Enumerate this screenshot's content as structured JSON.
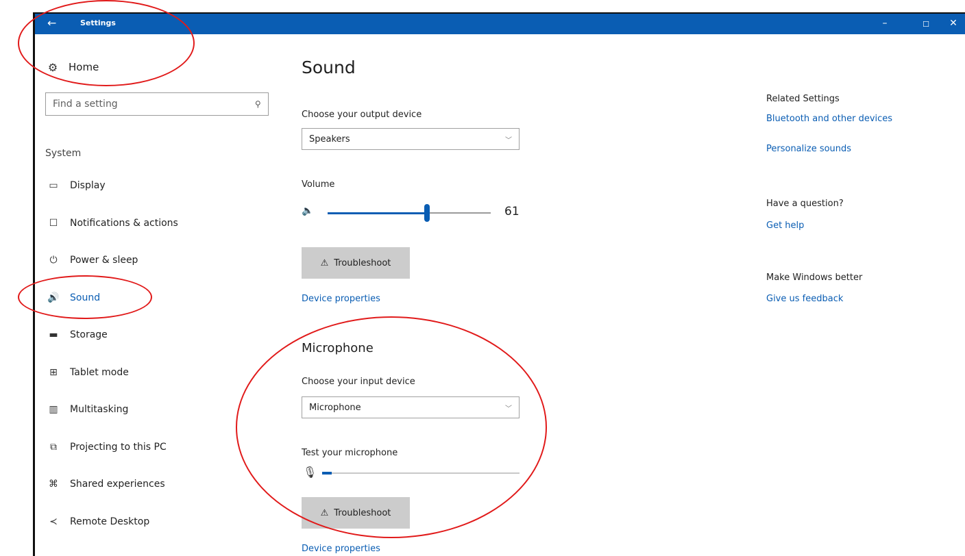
{
  "window": {
    "title": "Settings",
    "back_icon": "←",
    "min_icon": "–",
    "max_icon": "☐",
    "close_icon": "✕"
  },
  "sidebar": {
    "home_icon": "⚙",
    "home_label": "Home",
    "search_placeholder": "Find a setting",
    "search_icon": "⚲",
    "section_label": "System",
    "items": [
      {
        "label": "Display",
        "icon": "▭",
        "icon_name": "display-icon"
      },
      {
        "label": "Notifications & actions",
        "icon": "☐",
        "icon_name": "notifications-icon"
      },
      {
        "label": "Power & sleep",
        "icon": "⏻",
        "icon_name": "power-icon"
      },
      {
        "label": "Sound",
        "icon": "🔊",
        "icon_name": "sound-icon",
        "active": true
      },
      {
        "label": "Storage",
        "icon": "▬",
        "icon_name": "storage-icon"
      },
      {
        "label": "Tablet mode",
        "icon": "⊞",
        "icon_name": "tablet-mode-icon"
      },
      {
        "label": "Multitasking",
        "icon": "▥",
        "icon_name": "multitasking-icon"
      },
      {
        "label": "Projecting to this PC",
        "icon": "⧉",
        "icon_name": "projecting-icon"
      },
      {
        "label": "Shared experiences",
        "icon": "⌘",
        "icon_name": "shared-experiences-icon"
      },
      {
        "label": "Remote Desktop",
        "icon": "≺",
        "icon_name": "remote-desktop-icon"
      }
    ]
  },
  "main": {
    "title": "Sound",
    "output": {
      "label": "Choose your output device",
      "value": "Speakers",
      "chevron": "﹀"
    },
    "volume": {
      "label": "Volume",
      "icon": "🔈",
      "value": 61,
      "value_text": "61"
    },
    "troubleshoot_label": "Troubleshoot",
    "troubleshoot_icon": "⚠",
    "device_properties": "Device properties",
    "microphone": {
      "heading": "Microphone",
      "input_label": "Choose your input device",
      "input_value": "Microphone",
      "chevron": "﹀",
      "test_label": "Test your microphone",
      "mic_icon": "🎙",
      "level": 0.05,
      "troubleshoot_label": "Troubleshoot",
      "troubleshoot_icon": "⚠",
      "device_properties": "Device properties"
    }
  },
  "right": {
    "related_heading": "Related Settings",
    "related_links": [
      "Bluetooth and other devices",
      "Personalize sounds"
    ],
    "question_heading": "Have a question?",
    "question_link": "Get help",
    "better_heading": "Make Windows better",
    "better_link": "Give us feedback"
  },
  "colors": {
    "accent": "#0a5db3",
    "annotation": "#e11a1a"
  }
}
